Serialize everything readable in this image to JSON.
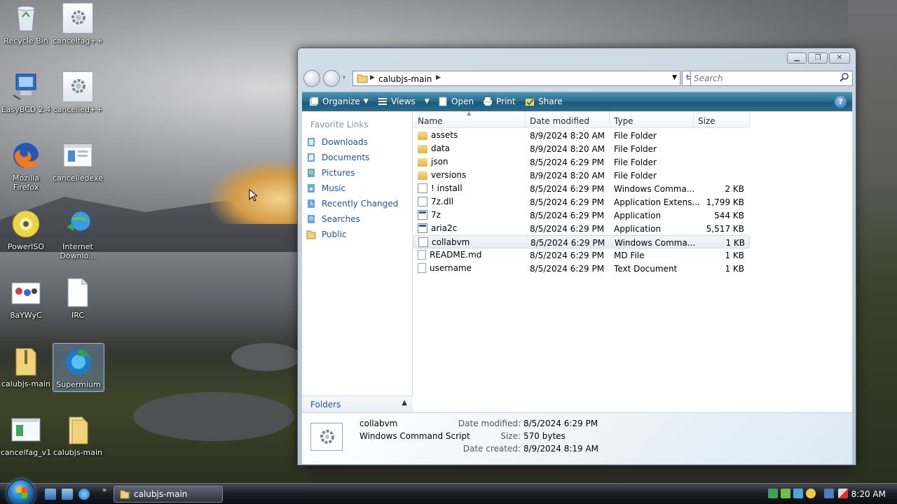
{
  "desktop": {
    "icons": [
      {
        "label": "Recycle Bin"
      },
      {
        "label": "cancelfag++"
      },
      {
        "label": "EasyBCD 2.4"
      },
      {
        "label": "cancelled++"
      },
      {
        "label": "Mozilla Firefox"
      },
      {
        "label": "cancelledexe"
      },
      {
        "label": "PowerISO"
      },
      {
        "label": "Internet Downlo..."
      },
      {
        "label": "8aYWyC"
      },
      {
        "label": "IRC"
      },
      {
        "label": "calubjs-main"
      },
      {
        "label": "Supermium"
      },
      {
        "label": "cancelfag_v1"
      },
      {
        "label": "calubjs-main"
      }
    ]
  },
  "window": {
    "address": {
      "crumb": "calubjs-main"
    },
    "search": {
      "placeholder": "Search"
    },
    "toolbar": {
      "organize": "Organize",
      "views": "Views",
      "open": "Open",
      "print": "Print",
      "share": "Share",
      "help": "?"
    },
    "nav": {
      "header": "Favorite Links",
      "items": [
        {
          "label": "Downloads"
        },
        {
          "label": "Documents"
        },
        {
          "label": "Pictures"
        },
        {
          "label": "Music"
        },
        {
          "label": "Recently Changed"
        },
        {
          "label": "Searches"
        },
        {
          "label": "Public"
        }
      ],
      "folders_label": "Folders"
    },
    "columns": [
      "Name",
      "Date modified",
      "Type",
      "Size"
    ],
    "files": [
      {
        "name": "assets",
        "date": "8/9/2024 8:20 AM",
        "type": "File Folder",
        "size": "",
        "kind": "folder"
      },
      {
        "name": "data",
        "date": "8/9/2024 8:20 AM",
        "type": "File Folder",
        "size": "",
        "kind": "folder"
      },
      {
        "name": "json",
        "date": "8/5/2024 6:29 PM",
        "type": "File Folder",
        "size": "",
        "kind": "folder"
      },
      {
        "name": "versions",
        "date": "8/9/2024 8:20 AM",
        "type": "File Folder",
        "size": "",
        "kind": "folder"
      },
      {
        "name": "! install",
        "date": "8/5/2024 6:29 PM",
        "type": "Windows Comma...",
        "size": "2 KB",
        "kind": "script"
      },
      {
        "name": "7z.dll",
        "date": "8/5/2024 6:29 PM",
        "type": "Application Extens...",
        "size": "1,799 KB",
        "kind": "script"
      },
      {
        "name": "7z",
        "date": "8/5/2024 6:29 PM",
        "type": "Application",
        "size": "544 KB",
        "kind": "app"
      },
      {
        "name": "aria2c",
        "date": "8/5/2024 6:29 PM",
        "type": "Application",
        "size": "5,517 KB",
        "kind": "app"
      },
      {
        "name": "collabvm",
        "date": "8/5/2024 6:29 PM",
        "type": "Windows Comma...",
        "size": "1 KB",
        "kind": "script"
      },
      {
        "name": "README.md",
        "date": "8/5/2024 6:29 PM",
        "type": "MD File",
        "size": "1 KB",
        "kind": "doc"
      },
      {
        "name": "username",
        "date": "8/5/2024 6:29 PM",
        "type": "Text Document",
        "size": "1 KB",
        "kind": "doc"
      }
    ],
    "details": {
      "name": "collabvm",
      "type": "Windows Command Script",
      "date_modified_label": "Date modified:",
      "date_modified": "8/5/2024 6:29 PM",
      "size_label": "Size:",
      "size": "570 bytes",
      "date_created_label": "Date created:",
      "date_created": "8/9/2024 8:19 AM"
    }
  },
  "taskbar": {
    "task_label": "calubjs-main",
    "clock": "8:20 AM"
  }
}
